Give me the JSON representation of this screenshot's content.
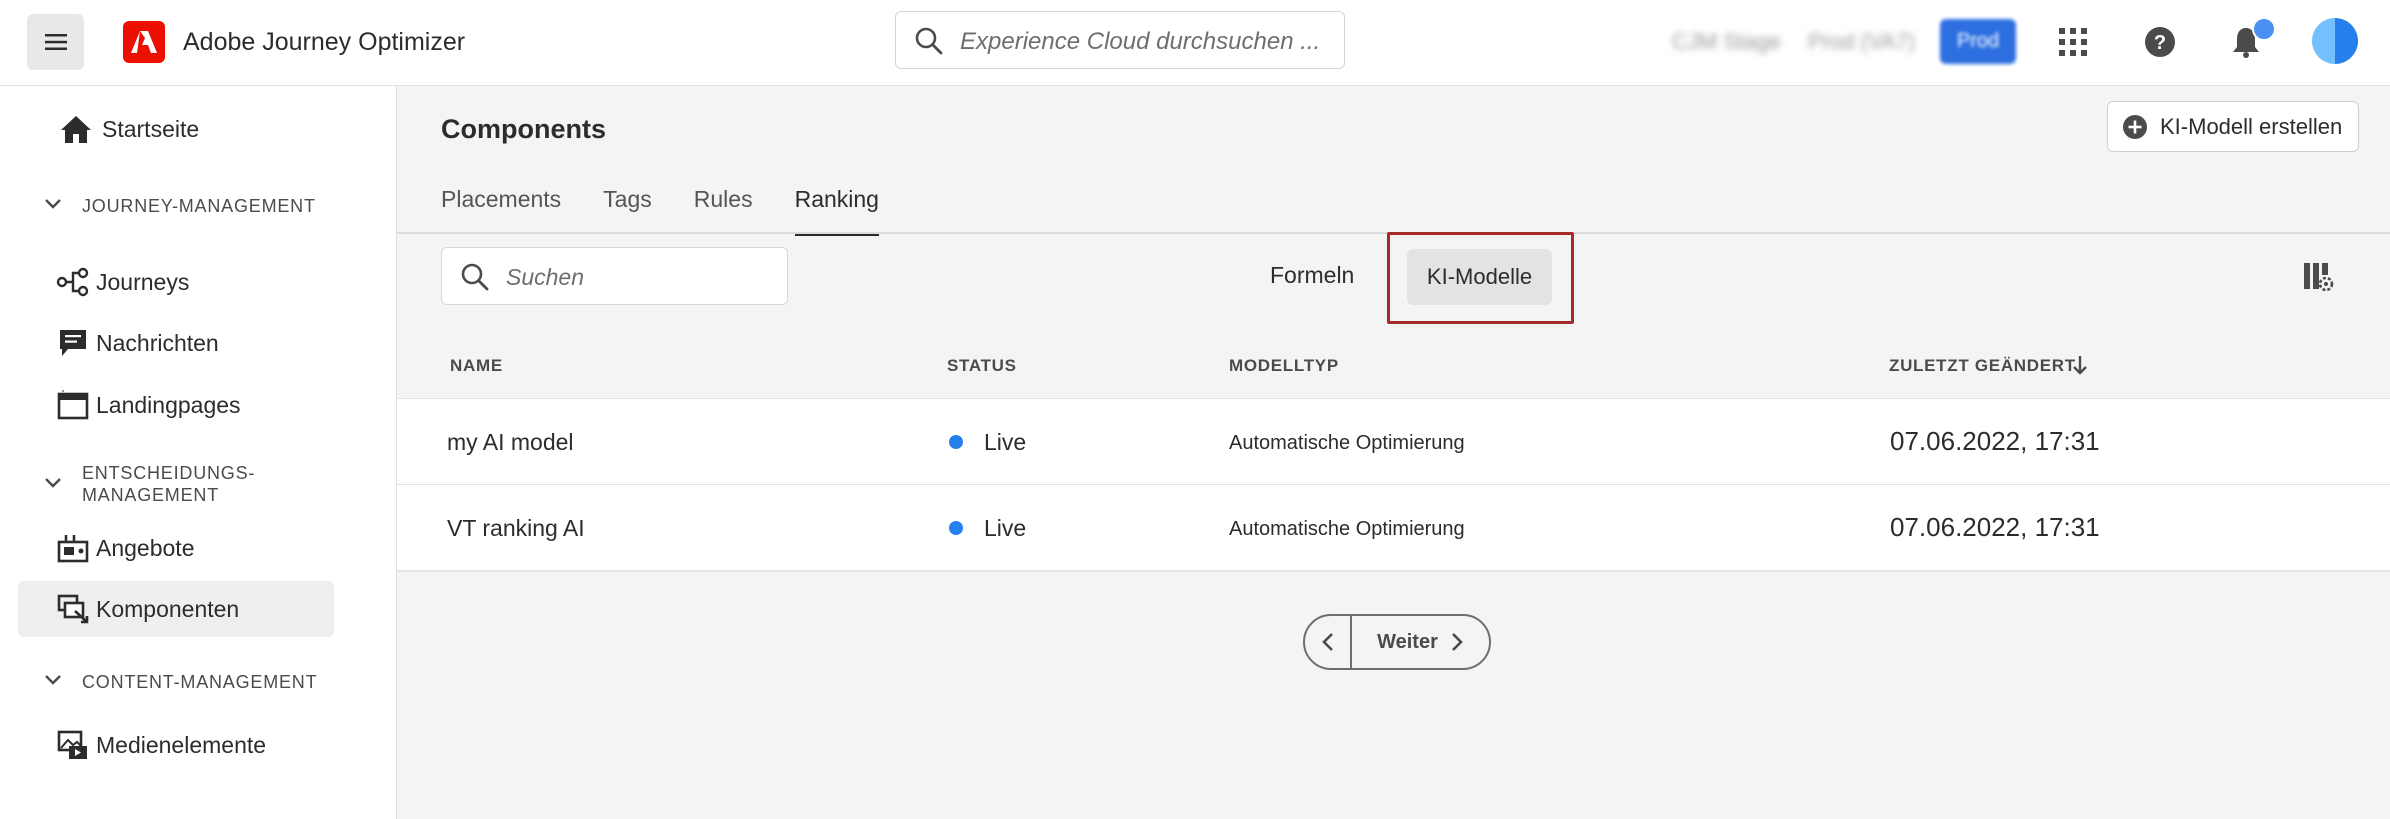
{
  "header": {
    "app_title": "Adobe Journey Optimizer",
    "search_placeholder": "Experience Cloud durchsuchen ...",
    "org_1": "CJM Stage",
    "org_2": "Prod (VA7)",
    "sandbox_button": "Prod"
  },
  "sidebar": {
    "home": "Startseite",
    "section_journey": "JOURNEY-MANAGEMENT",
    "journeys": "Journeys",
    "messages": "Nachrichten",
    "landing_pages": "Landingpages",
    "section_decision_line1": "ENTSCHEIDUNGS-",
    "section_decision_line2": "MANAGEMENT",
    "offers": "Angebote",
    "components": "Komponenten",
    "section_content": "CONTENT-MANAGEMENT",
    "media": "Medienelemente"
  },
  "main": {
    "title": "Components",
    "create_button": "KI-Modell erstellen",
    "tabs": [
      "Placements",
      "Tags",
      "Rules",
      "Ranking"
    ],
    "search_placeholder": "Suchen",
    "segment_formulas": "Formeln",
    "segment_ai_models": "KI-Modelle",
    "columns": {
      "name": "NAME",
      "status": "STATUS",
      "model_type": "MODELLTYP",
      "last_modified": "ZULETZT GEÄNDERT"
    },
    "rows": [
      {
        "name": "my AI model",
        "status": "Live",
        "type": "Automatische Optimierung",
        "date": "07.06.2022, 17:31"
      },
      {
        "name": "VT ranking AI",
        "status": "Live",
        "type": "Automatische Optimierung",
        "date": "07.06.2022, 17:31"
      }
    ],
    "pager_next": "Weiter"
  },
  "colors": {
    "accent_blue": "#2680eb",
    "brand_red": "#eb1000",
    "highlight_box": "#a62a2a"
  }
}
